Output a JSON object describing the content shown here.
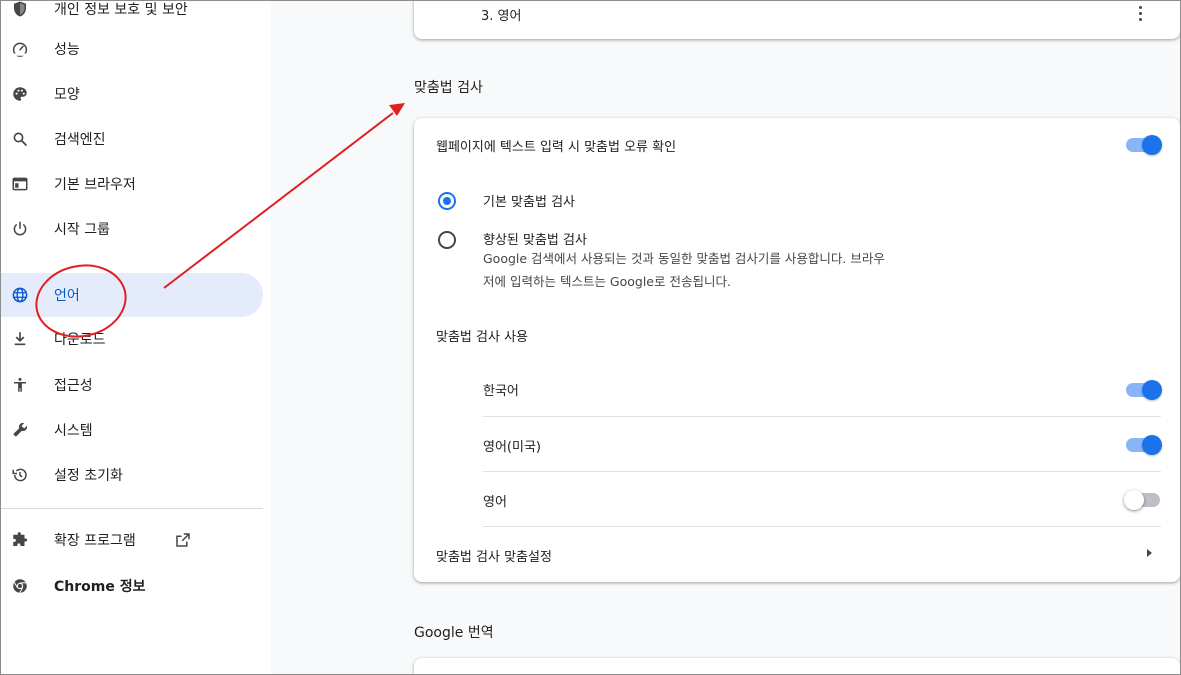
{
  "sidebar": {
    "items": [
      {
        "label": "개인 정보 보호 및 보안",
        "icon": "shield-icon"
      },
      {
        "label": "성능",
        "icon": "speedometer-icon"
      },
      {
        "label": "모양",
        "icon": "palette-icon"
      },
      {
        "label": "검색엔진",
        "icon": "search-icon"
      },
      {
        "label": "기본 브라우저",
        "icon": "browser-window-icon"
      },
      {
        "label": "시작 그룹",
        "icon": "power-icon"
      },
      {
        "label": "언어",
        "icon": "globe-icon"
      },
      {
        "label": "다운로드",
        "icon": "download-icon"
      },
      {
        "label": "접근성",
        "icon": "accessibility-icon"
      },
      {
        "label": "시스템",
        "icon": "wrench-icon"
      },
      {
        "label": "설정 초기화",
        "icon": "history-icon"
      }
    ],
    "extensions_label": "확장 프로그램",
    "about_label": "Chrome 정보",
    "active_item": "언어",
    "accent_color": "#0b57d0",
    "active_bg": "#e4ecfb"
  },
  "languages_card": {
    "last_item_label": "3. 영어"
  },
  "spellcheck": {
    "section_title": "맞춤법 검사",
    "toggle_label": "웹페이지에 텍스트 입력 시 맞춤법 오류 확인",
    "toggle_on": true,
    "basic_option": "기본 맞춤법 검사",
    "enhanced_option": "향상된 맞춤법 검사",
    "enhanced_desc_line1": "Google 검색에서 사용되는 것과 동일한 맞춤법 검사기를 사용합니다. 브라우",
    "enhanced_desc_line2": "저에 입력하는 텍스트는 Google로 전송됩니다.",
    "selected_option": "기본 맞춤법 검사",
    "use_title": "맞춤법 검사 사용",
    "languages": [
      {
        "label": "한국어",
        "on": true
      },
      {
        "label": "영어(미국)",
        "on": true
      },
      {
        "label": "영어",
        "on": false
      }
    ],
    "customize_label": "맞춤법 검사 맞춤설정"
  },
  "translate": {
    "section_title": "Google 번역"
  },
  "colors": {
    "toggle_on": "#1a73e8",
    "annotation_red": "#e02020"
  }
}
